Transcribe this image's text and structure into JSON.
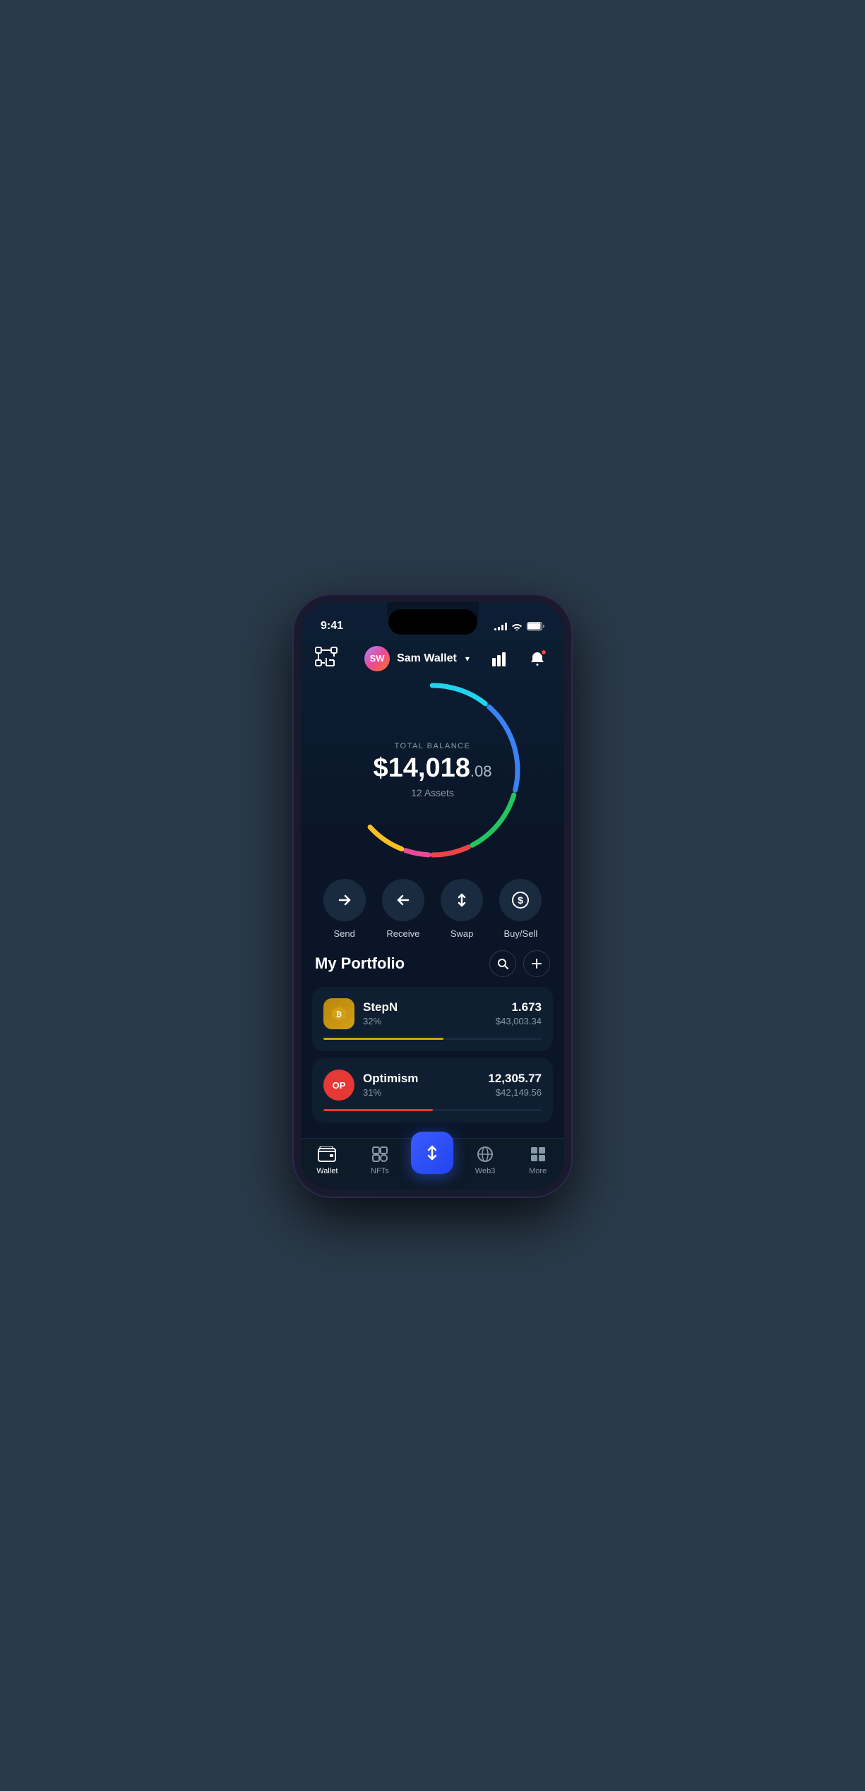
{
  "statusBar": {
    "time": "9:41",
    "signalBars": [
      3,
      5,
      8,
      11,
      11
    ],
    "batteryLevel": 100
  },
  "header": {
    "avatarInitials": "SW",
    "userName": "Sam Wallet",
    "scanIconLabel": "scan",
    "chartIconLabel": "chart",
    "notifIconLabel": "notifications"
  },
  "balance": {
    "label": "TOTAL BALANCE",
    "whole": "$14,018",
    "cents": ".08",
    "assets": "12 Assets"
  },
  "actions": [
    {
      "id": "send",
      "label": "Send",
      "icon": "→"
    },
    {
      "id": "receive",
      "label": "Receive",
      "icon": "←"
    },
    {
      "id": "swap",
      "label": "Swap",
      "icon": "⇅"
    },
    {
      "id": "buysell",
      "label": "Buy/Sell",
      "icon": "$"
    }
  ],
  "portfolio": {
    "title": "My Portfolio",
    "searchLabel": "search",
    "addLabel": "add",
    "assets": [
      {
        "name": "StepN",
        "pct": "32%",
        "amount": "1.673",
        "value": "$43,003.34",
        "barColor": "#d4a017",
        "barWidth": "55%",
        "logoType": "stepn"
      },
      {
        "name": "Optimism",
        "pct": "31%",
        "amount": "12,305.77",
        "value": "$42,149.56",
        "barColor": "#e53935",
        "barWidth": "50%",
        "logoType": "op"
      }
    ]
  },
  "tabBar": {
    "tabs": [
      {
        "id": "wallet",
        "label": "Wallet",
        "active": true
      },
      {
        "id": "nfts",
        "label": "NFTs",
        "active": false
      },
      {
        "id": "center",
        "label": "",
        "active": false
      },
      {
        "id": "web3",
        "label": "Web3",
        "active": false
      },
      {
        "id": "more",
        "label": "More",
        "active": false
      }
    ]
  },
  "colors": {
    "circleSegments": [
      {
        "color": "#22d3ee",
        "start": 0,
        "length": 60
      },
      {
        "color": "#3b82f6",
        "start": 65,
        "length": 100
      },
      {
        "color": "#22c55e",
        "start": 170,
        "length": 70
      },
      {
        "color": "#ef4444",
        "start": 245,
        "length": 40
      },
      {
        "color": "#ec4899",
        "start": 288,
        "length": 25
      },
      {
        "color": "#fbbf24",
        "start": 316,
        "length": 40
      }
    ]
  }
}
